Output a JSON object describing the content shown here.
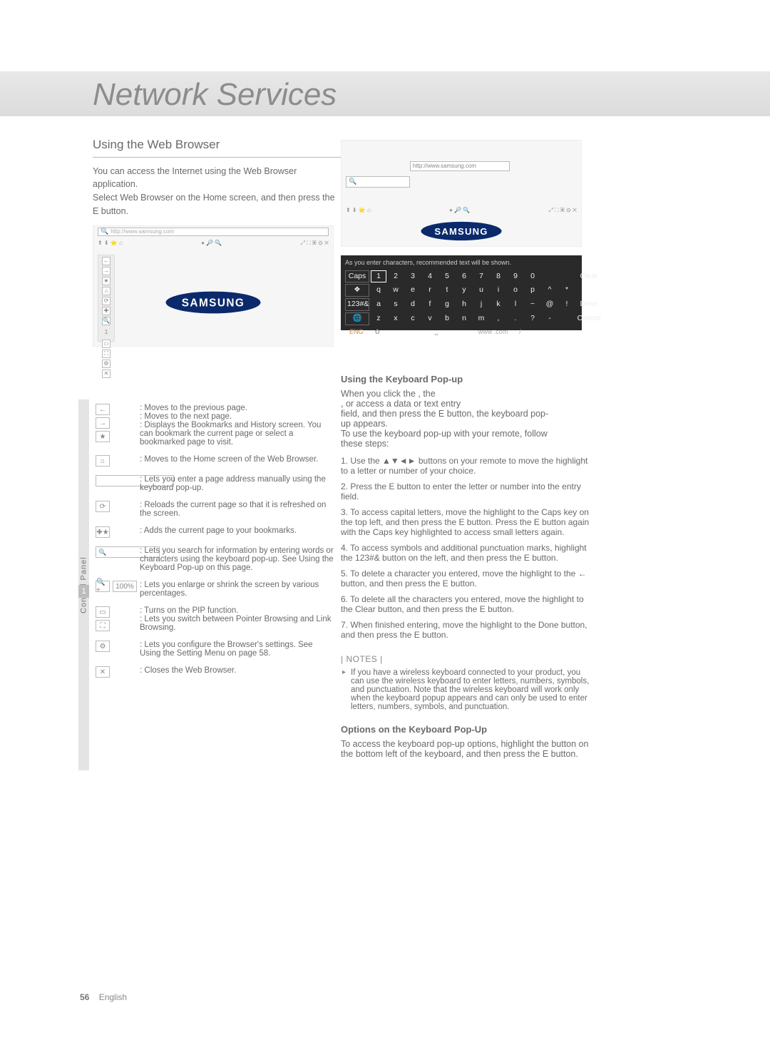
{
  "header": {
    "title": "Network Services"
  },
  "left": {
    "section_title": "Using the Web Browser",
    "para": "You can access the Internet using the Web Browser application.\nSelect Web Browser on the Home screen, and then press the E button."
  },
  "thumb_a": {
    "url_placeholder": "http://www.samsung.com",
    "iconrow_left": "⬆ ⬇ ⭐ ⌂",
    "iconrow_mid": "● 🔎 🔍",
    "iconrow_right": "⤢  ⛶ ▣ ⚙ ✕"
  },
  "thumb_b": {
    "url_input": "http://www.samsung.com",
    "iconrow_left": "⬆ ⬇ ⭐ ⌂",
    "iconrow_mid": "● 🔎 🔍",
    "iconrow_right": "⤢  ⛶ ▣ ⚙ ✕"
  },
  "keyboard": {
    "hint": "As you enter characters, recommended text will be shown.",
    "row1_first": "Caps",
    "row1_keys": [
      "1",
      "2",
      "3",
      "4",
      "5",
      "6",
      "7",
      "8",
      "9",
      "0",
      "",
      ""
    ],
    "row1_last": "Clear",
    "row2_first": "❖",
    "row2_keys": [
      "q",
      "w",
      "e",
      "r",
      "t",
      "y",
      "u",
      "i",
      "o",
      "p",
      "^",
      "*"
    ],
    "row2_last": "",
    "row3_first": "123#&",
    "row3_keys": [
      "a",
      "s",
      "d",
      "f",
      "g",
      "h",
      "j",
      "k",
      "l",
      "~",
      "@",
      "!"
    ],
    "row3_last": "Done",
    "row4_first": "🌐",
    "row4_keys": [
      "z",
      "x",
      "c",
      "v",
      "b",
      "n",
      "m",
      ",",
      ".",
      "?",
      "-",
      ""
    ],
    "row4_last": "Cancel",
    "bottom": {
      "eng": "ENG",
      "gear": "✿",
      "space": "␣",
      "www": "www .com",
      "slash": "/"
    }
  },
  "ctrl": {
    "label": "Control Panel",
    "number": "1",
    "rows": [
      {
        "icons": [
          {
            "t": "ibox",
            "g": "←"
          },
          {
            "t": "ibox",
            "g": "→"
          },
          {
            "t": "ibox",
            "g": "★"
          }
        ],
        "text": ": Moves to the previous page.\n: Moves to the next page.\n: Displays the Bookmarks and History screen. You can bookmark the current page or select a bookmarked page to visit."
      },
      {
        "icons": [
          {
            "t": "ibox",
            "g": "⌂"
          }
        ],
        "text": ": Moves to the Home screen of the Web Browser."
      },
      {
        "icons": [
          {
            "t": "longbox"
          }
        ],
        "text": ": Lets you enter a page address manually using the keyboard pop-up."
      },
      {
        "icons": [
          {
            "t": "ibox",
            "g": "⟳"
          }
        ],
        "text": ": Reloads the current page so that it is refreshed on the screen."
      },
      {
        "icons": [
          {
            "t": "ibox",
            "g": "✚★"
          }
        ],
        "text": ": Adds the current page to your bookmarks."
      },
      {
        "icons": [
          {
            "t": "searchbox",
            "g": "🔍"
          }
        ],
        "text": ": Lets you search for information by entering words or characters using the keyboard pop-up. See Using the Keyboard Pop-up on this page."
      },
      {
        "icons": [
          {
            "t": "pair",
            "g1": "🔍+",
            "g2": "100%"
          }
        ],
        "text": ": Lets you enlarge or shrink the screen by various percentages."
      },
      {
        "icons": [
          {
            "t": "ibox",
            "g": "▭"
          },
          {
            "t": "ibox",
            "g": "⛶"
          }
        ],
        "text": ": Turns on the PIP function.\n: Lets you switch between Pointer Browsing and Link Browsing."
      },
      {
        "icons": [
          {
            "t": "ibox",
            "g": "⚙"
          }
        ],
        "text": ": Lets you configure the Browser's settings. See Using the Setting Menu on page 58."
      },
      {
        "icons": [
          {
            "t": "ibox",
            "g": "✕"
          }
        ],
        "text": ": Closes the Web Browser."
      }
    ]
  },
  "right_lower": {
    "kp_title": "Using the Keyboard Pop-up",
    "kp_para": "When you click the                                    , the\n                            , or access a data or text entry\nfield, and then press the E button, the keyboard pop-\nup appears.\nTo use the keyboard pop-up with your remote, follow\nthese steps:",
    "steps": [
      "1. Use the ▲▼◄► buttons on your remote to move the highlight to a letter or number of your choice.",
      "2. Press the E button to enter the letter or number into the entry field.",
      "3. To access capital letters, move the highlight to the Caps key on the top left, and then press the E button. Press the E button again with the Caps key highlighted to access small letters again.",
      "4. To access symbols and additional punctuation marks, highlight the 123#& button on the left, and then press the E button.",
      "5. To delete a character you entered, move the highlight to the ← button, and then press the E button.",
      "6. To delete all the characters you entered, move the highlight to the Clear button, and then press the E button.",
      "7. When finished entering, move the highlight to the Done button, and then press the E button."
    ],
    "notes_head": "| NOTES |",
    "notes": [
      "If you have a wireless keyboard connected to your product, you can use the wireless keyboard to enter letters, numbers, symbols, and punctuation. Note that the wireless keyboard will work only when the keyboard popup appears and can only be used to enter letters, numbers, symbols, and punctuation."
    ],
    "options_title": "Options on the Keyboard Pop-Up",
    "options_para": "To access the keyboard pop-up options, highlight the    button on the bottom left of the keyboard, and then press the E button."
  },
  "page_url_label": "http://www.samsung.com",
  "footer": {
    "page": "56",
    "section": "English"
  }
}
